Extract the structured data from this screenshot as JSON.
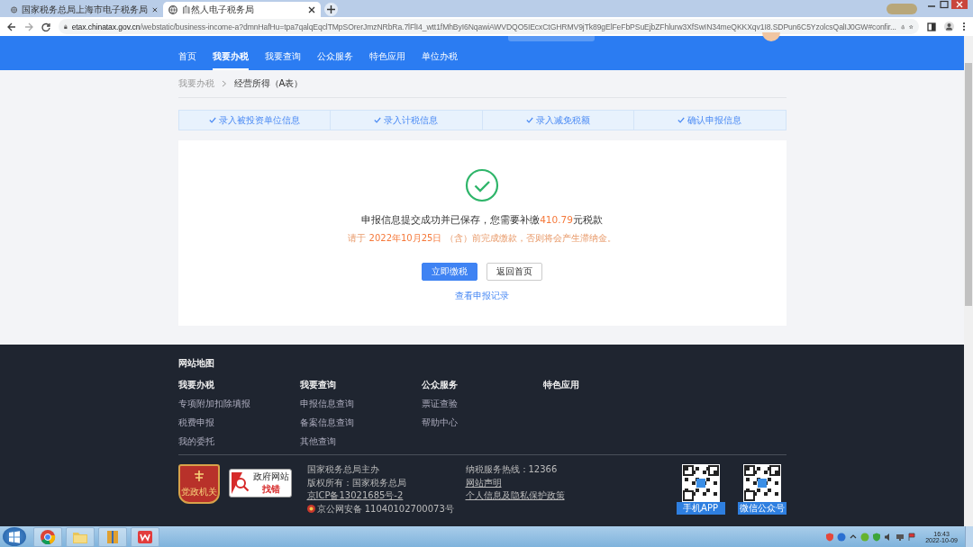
{
  "browser": {
    "tabs": [
      {
        "title": "国家税务总局上海市电子税务局",
        "selected": false
      },
      {
        "title": "自然人电子税务局",
        "selected": true
      }
    ],
    "address": "etax.chinatax.gov.cn/webstatic/business-income-a?dmnHafHu=tpa7qalqEqclTMpSOrerJmzNRbRa.7lFlI4_wtt1fMhByI6NqawiAWVDQO5IEcxCtGHRMV9jTk89gElFeFbPSuEjbZFhlurw3XfSwIN34meQKKXqv1I8.SDPun6C5YzolcsQalIJ0GW#confir..."
  },
  "nav": [
    {
      "label": "首页",
      "selected": false
    },
    {
      "label": "我要办税",
      "selected": true
    },
    {
      "label": "我要查询",
      "selected": false
    },
    {
      "label": "公众服务",
      "selected": false
    },
    {
      "label": "特色应用",
      "selected": false
    },
    {
      "label": "单位办税",
      "selected": false
    }
  ],
  "breadcrumb": [
    {
      "label": "我要办税",
      "current": false
    },
    {
      "label": "经营所得（A表）",
      "current": true
    }
  ],
  "steps": [
    {
      "label": "录入被投资单位信息",
      "done": true
    },
    {
      "label": "录入计税信息",
      "done": true
    },
    {
      "label": "录入减免税额",
      "done": true
    },
    {
      "label": "确认申报信息",
      "done": true
    }
  ],
  "result": {
    "message_before": "申报信息提交成功并已保存，您需要补缴",
    "amount": "410.79",
    "message_after": "元税款",
    "notice_before": "请于",
    "deadline": "2022年10月25日",
    "notice_after": "（含）前完成缴款，否则将会产生滞纳金。",
    "buttons": [
      {
        "label": "立即缴税",
        "kind": "primary"
      },
      {
        "label": "返回首页",
        "kind": "secondary"
      }
    ],
    "link": "查看申报记录"
  },
  "footer": {
    "title": "网站地图",
    "columns": [
      {
        "heading": "我要办税",
        "links": [
          "专项附加扣除填报",
          "税费申报",
          "我的委托"
        ]
      },
      {
        "heading": "我要查询",
        "links": [
          "申报信息查询",
          "备案信息查询",
          "其他查询"
        ]
      },
      {
        "heading": "公众服务",
        "links": [
          "票证查验",
          "帮助中心"
        ]
      },
      {
        "heading": "特色应用"
      }
    ],
    "emblem": "党政机关",
    "report_badge": {
      "line1": "政府网站",
      "line2": "找错"
    },
    "info_left": [
      {
        "text": "国家税务总局主办",
        "link": false
      },
      {
        "text": "版权所有：国家税务总局",
        "link": false
      },
      {
        "text": "京ICP备13021685号-2",
        "link": true
      },
      {
        "text": "京公网安备 11040102700073号",
        "link": false
      }
    ],
    "info_right": [
      {
        "text": "纳税服务热线：12366",
        "link": false
      },
      {
        "text": "网站声明",
        "link": true
      },
      {
        "text": "个人信息及隐私保护政策",
        "link": true
      }
    ],
    "qr_codes": [
      {
        "label": "手机APP"
      },
      {
        "label": "微信公众号"
      }
    ]
  },
  "taskbar": {
    "time": "16:43",
    "date": "2022-10-09"
  }
}
